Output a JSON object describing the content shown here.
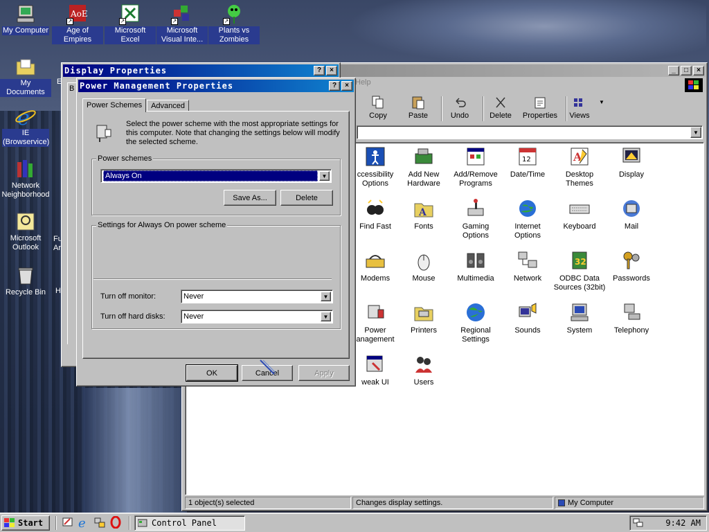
{
  "desktop": {
    "icons": [
      {
        "label": "My Computer"
      },
      {
        "label": "Age of Empires"
      },
      {
        "label": "Microsoft Excel"
      },
      {
        "label": "Microsoft Visual Inte..."
      },
      {
        "label": "Plants vs Zombies"
      },
      {
        "label": "My Documents"
      },
      {
        "label": "IE (Browservice)"
      },
      {
        "label": "Network Neighborhood"
      },
      {
        "label": "Microsoft Outlook"
      },
      {
        "label": "Recycle Bin"
      }
    ],
    "partial": [
      "E",
      "Fu",
      "Ar",
      "H"
    ]
  },
  "control_panel": {
    "menu_help": "Help",
    "toolbar": [
      {
        "label": "Copy",
        "icon": "copy-icon"
      },
      {
        "label": "Paste",
        "icon": "paste-icon"
      },
      {
        "label": "Undo",
        "icon": "undo-icon"
      },
      {
        "label": "Delete",
        "icon": "delete-icon"
      },
      {
        "label": "Properties",
        "icon": "properties-icon"
      },
      {
        "label": "Views",
        "icon": "views-icon"
      }
    ],
    "items": [
      {
        "label": "ccessibility Options"
      },
      {
        "label": "Add New Hardware"
      },
      {
        "label": "Add/Remove Programs"
      },
      {
        "label": "Date/Time"
      },
      {
        "label": "Desktop Themes"
      },
      {
        "label": "Display"
      },
      {
        "label": "Find Fast"
      },
      {
        "label": "Fonts"
      },
      {
        "label": "Gaming Options"
      },
      {
        "label": "Internet Options"
      },
      {
        "label": "Keyboard"
      },
      {
        "label": "Mail"
      },
      {
        "label": "Modems"
      },
      {
        "label": "Mouse"
      },
      {
        "label": "Multimedia"
      },
      {
        "label": "Network"
      },
      {
        "label": "ODBC Data Sources (32bit)"
      },
      {
        "label": "Passwords"
      },
      {
        "label": "Power anagement"
      },
      {
        "label": "Printers"
      },
      {
        "label": "Regional Settings"
      },
      {
        "label": "Sounds"
      },
      {
        "label": "System"
      },
      {
        "label": "Telephony"
      },
      {
        "label": "weak UI"
      },
      {
        "label": "Users"
      }
    ],
    "status": {
      "selected": "1 object(s) selected",
      "description": "Changes display settings.",
      "location": "My Computer"
    }
  },
  "display_properties": {
    "title": "Display Properties",
    "tab_partial": "B"
  },
  "power_mgmt": {
    "title": "Power Management Properties",
    "tabs": [
      "Power Schemes",
      "Advanced"
    ],
    "description": "Select the power scheme with the most appropriate settings for this computer. Note that changing the settings below will modify the selected scheme.",
    "schemes_label": "Power schemes",
    "scheme_value": "Always On",
    "save_as": "Save As...",
    "delete": "Delete",
    "settings_label": "Settings for Always On power scheme",
    "monitor_label": "Turn off monitor:",
    "monitor_value": "Never",
    "disks_label": "Turn off hard disks:",
    "disks_value": "Never",
    "ok": "OK",
    "cancel": "Cancel",
    "apply": "Apply"
  },
  "taskbar": {
    "start": "Start",
    "task": "Control Panel",
    "clock": "9:42 AM"
  },
  "colors": {
    "titlebar_active": "#000080",
    "titlebar_gradient_end": "#1084d0",
    "selection": "#2a3b8f",
    "face": "#c0c0c0"
  }
}
